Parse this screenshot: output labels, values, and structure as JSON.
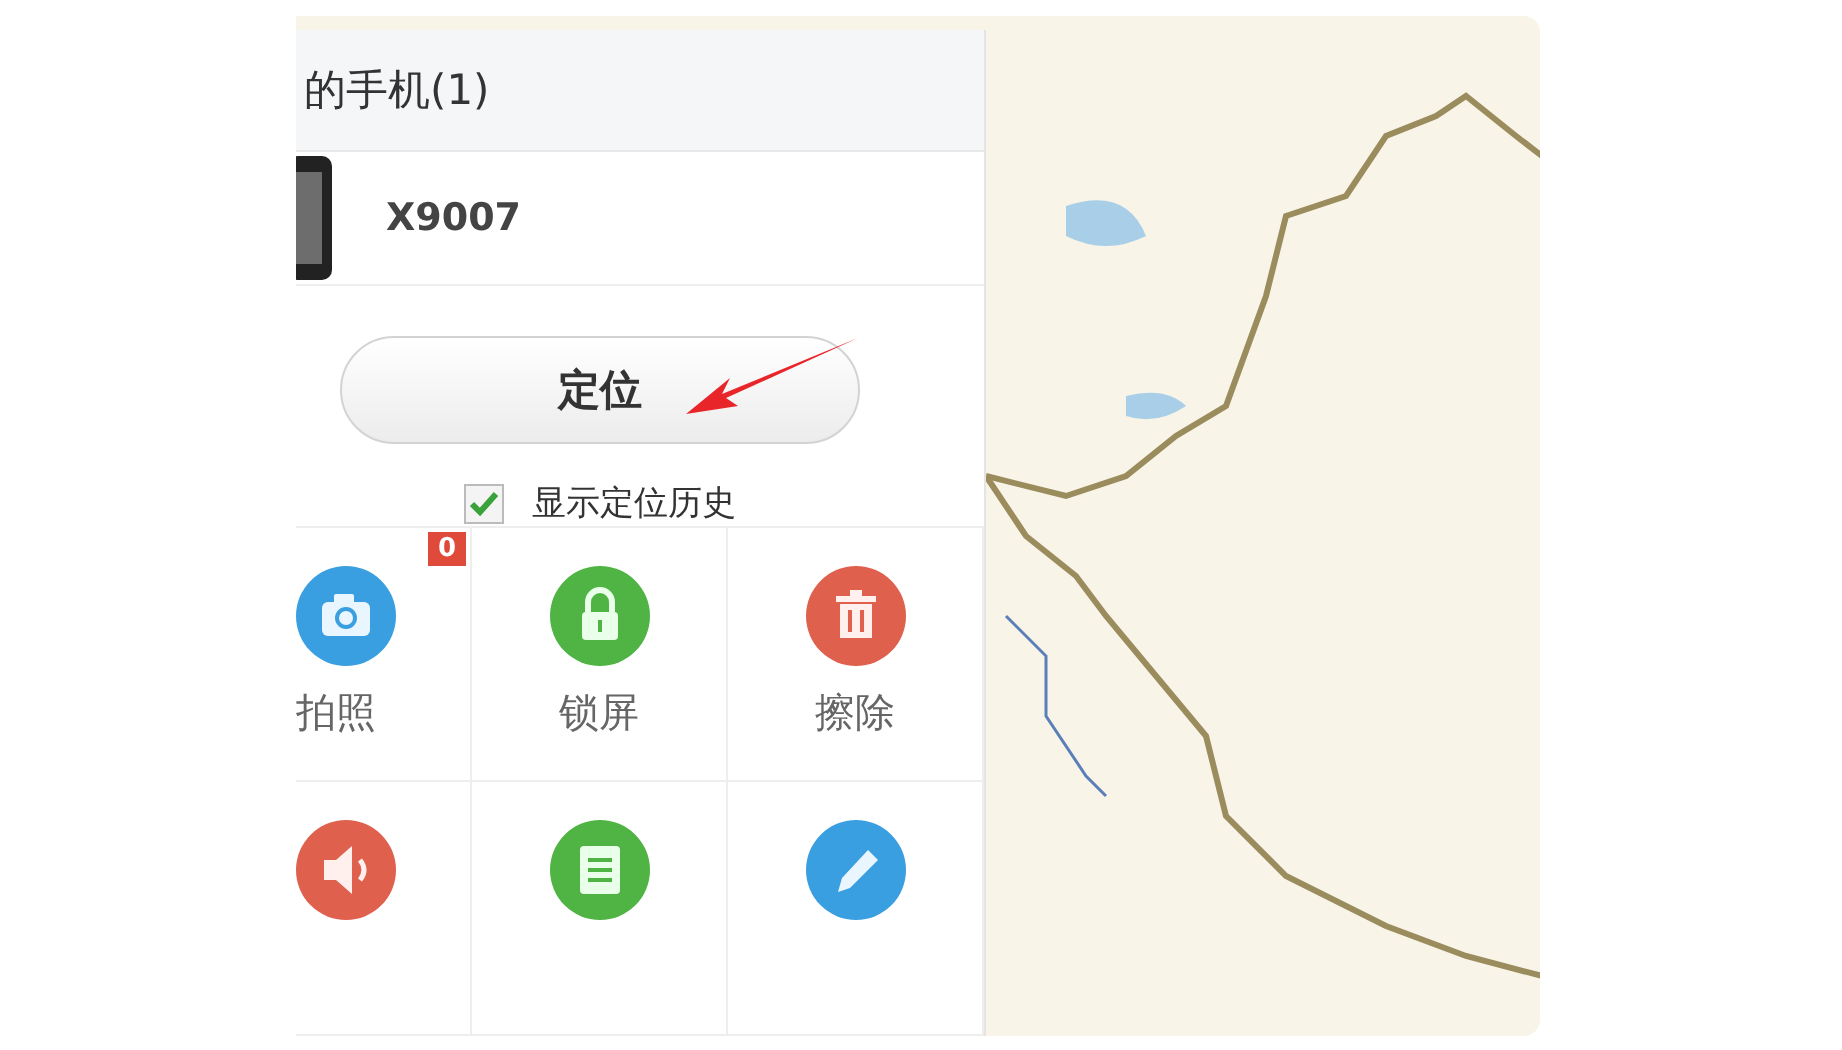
{
  "panel": {
    "title": "的手机(1)",
    "device": {
      "name": "X9007"
    },
    "locate_button": "定位",
    "show_history": {
      "label": "显示定位历史",
      "checked": true
    },
    "tools": [
      {
        "kind": "camera",
        "label": "拍照",
        "badge": "0"
      },
      {
        "kind": "lock",
        "label": "锁屏"
      },
      {
        "kind": "trash",
        "label": "擦除"
      },
      {
        "kind": "speaker"
      },
      {
        "kind": "list"
      },
      {
        "kind": "pen"
      }
    ]
  }
}
